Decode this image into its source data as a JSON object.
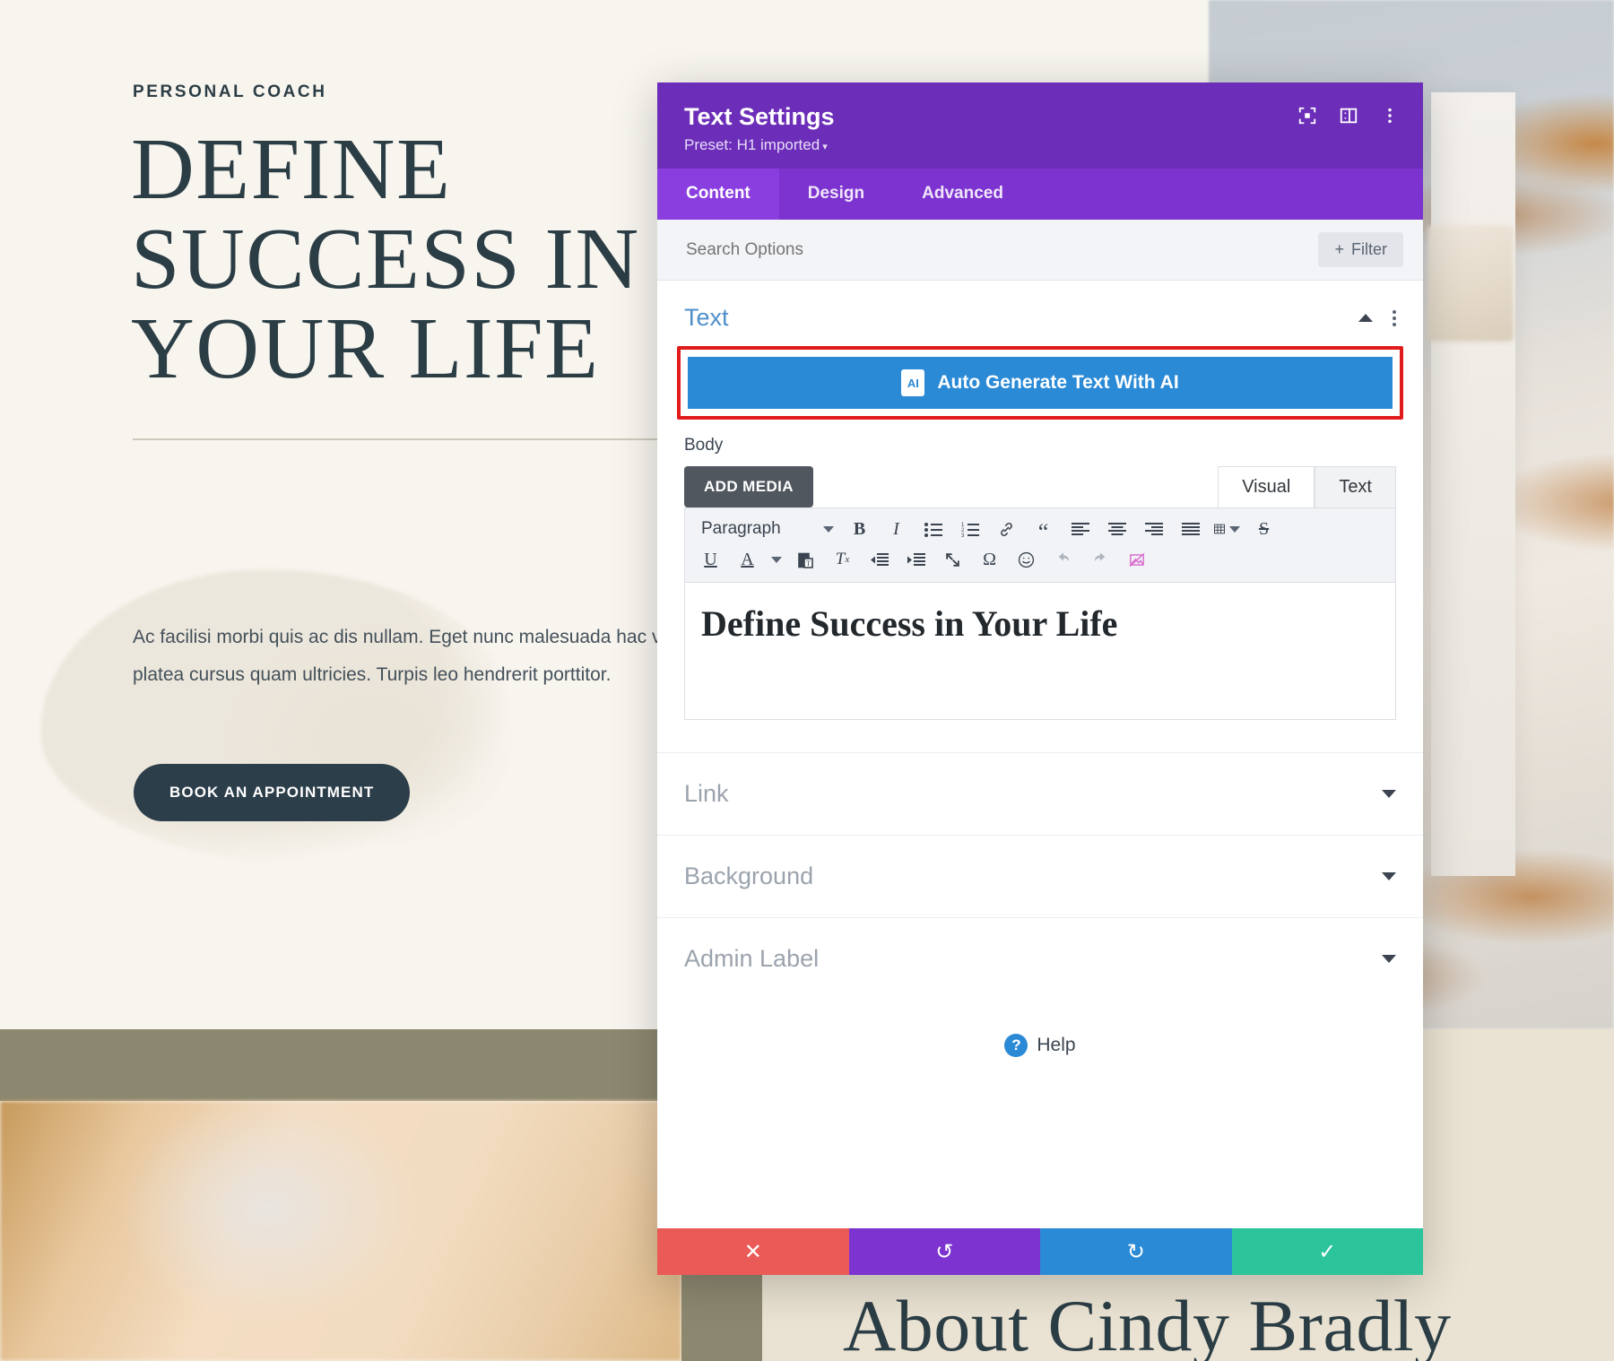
{
  "website": {
    "eyebrow": "PERSONAL COACH",
    "hero_title": "DEFINE\nSUCCESS IN\nYOUR LIFE",
    "paragraph": "Ac facilisi morbi quis ac dis nullam. Eget nunc malesuada hac vestibulum. Luctus praesent pretium augue tincidunt platea cursus quam ultricies. Turpis leo hendrerit porttitor.",
    "cta_label": "BOOK AN APPOINTMENT",
    "about_heading": "About Cindy Bradly",
    "colors": {
      "page_bg": "#f8f5ef",
      "ink": "#2b3d45",
      "olive_band": "#8c8870",
      "sand_band": "#eae3d3"
    }
  },
  "modal": {
    "title": "Text Settings",
    "preset": "Preset: H1 imported",
    "preset_caret": "▾",
    "header_icons": [
      {
        "name": "focus-icon"
      },
      {
        "name": "layout-panel-icon"
      },
      {
        "name": "more-vertical-icon"
      }
    ],
    "tabs": [
      {
        "label": "Content",
        "active": true
      },
      {
        "label": "Design",
        "active": false
      },
      {
        "label": "Advanced",
        "active": false
      }
    ],
    "search": {
      "placeholder": "Search Options",
      "value": ""
    },
    "filter_label": "Filter",
    "filter_plus": "+",
    "section": {
      "title": "Text",
      "collapse_icon": "chevron-up-icon",
      "menu_icon": "more-vertical-icon"
    },
    "ai_button": {
      "label": "Auto Generate Text With AI",
      "badge": "AI",
      "highlight_color": "#e01b1b",
      "bg_color": "#2b8ad6"
    },
    "body_field": {
      "label": "Body",
      "add_media_label": "ADD MEDIA",
      "view_tabs": [
        {
          "label": "Visual",
          "active": true
        },
        {
          "label": "Text",
          "active": false
        }
      ],
      "format_select": "Paragraph",
      "toolbar_row1": [
        {
          "name": "bold-icon",
          "glyph": "B"
        },
        {
          "name": "italic-icon",
          "glyph": "I"
        },
        {
          "name": "bulleted-list-icon",
          "glyph": "☰"
        },
        {
          "name": "numbered-list-icon",
          "glyph": "≡"
        },
        {
          "name": "link-icon",
          "glyph": "🔗"
        },
        {
          "name": "blockquote-icon",
          "glyph": "❝"
        },
        {
          "name": "align-left-icon",
          "glyph": "≡"
        },
        {
          "name": "align-center-icon",
          "glyph": "≡"
        },
        {
          "name": "align-right-icon",
          "glyph": "≡"
        },
        {
          "name": "align-justify-icon",
          "glyph": "≡"
        },
        {
          "name": "table-icon",
          "glyph": "▦"
        },
        {
          "name": "strikethrough-icon",
          "glyph": "S"
        }
      ],
      "toolbar_row2": [
        {
          "name": "underline-icon",
          "glyph": "U"
        },
        {
          "name": "text-color-icon",
          "glyph": "A"
        },
        {
          "name": "paste-as-text-icon",
          "glyph": "📋"
        },
        {
          "name": "clear-formatting-icon",
          "glyph": "Tx"
        },
        {
          "name": "outdent-icon",
          "glyph": "⇤"
        },
        {
          "name": "indent-icon",
          "glyph": "⇥"
        },
        {
          "name": "fullscreen-icon",
          "glyph": "⤢"
        },
        {
          "name": "special-character-icon",
          "glyph": "Ω"
        },
        {
          "name": "emoji-icon",
          "glyph": "☺"
        },
        {
          "name": "undo-icon",
          "glyph": "↩"
        },
        {
          "name": "redo-icon",
          "glyph": "↪"
        },
        {
          "name": "no-image-icon",
          "glyph": "⧅"
        }
      ],
      "content": "Define Success in Your Life"
    },
    "accordions": [
      {
        "label": "Link",
        "icon": "chevron-down-icon"
      },
      {
        "label": "Background",
        "icon": "chevron-down-icon"
      },
      {
        "label": "Admin Label",
        "icon": "chevron-down-icon"
      }
    ],
    "help": {
      "label": "Help",
      "icon": "question-circle-icon"
    },
    "footer_buttons": [
      {
        "name": "cancel-button",
        "glyph": "✕",
        "color": "#ea5a56"
      },
      {
        "name": "undo-button",
        "glyph": "↺",
        "color": "#7c33cf"
      },
      {
        "name": "redo-button",
        "glyph": "↻",
        "color": "#2b8ad6"
      },
      {
        "name": "save-button",
        "glyph": "✓",
        "color": "#2bc49b"
      }
    ]
  }
}
